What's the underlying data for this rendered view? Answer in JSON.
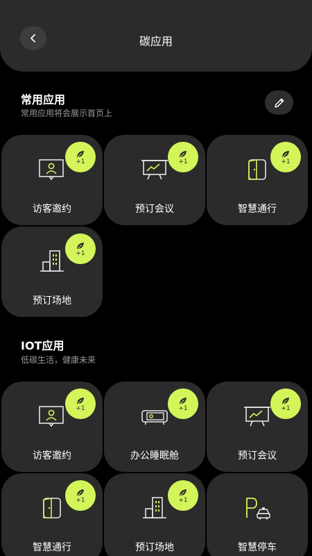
{
  "header": {
    "title": "碳应用"
  },
  "common": {
    "title": "常用应用",
    "subtitle": "常用应用将会展示首页上",
    "tiles": [
      {
        "label": "访客邀约",
        "icon": "visitor-icon",
        "badge": "+1"
      },
      {
        "label": "预订会议",
        "icon": "meeting-board-icon",
        "badge": "+1"
      },
      {
        "label": "智慧通行",
        "icon": "door-icon",
        "badge": "+1"
      },
      {
        "label": "预订场地",
        "icon": "building-icon",
        "badge": "+1"
      }
    ]
  },
  "iot": {
    "title": "IOT应用",
    "subtitle": "低碳生活，健康未来",
    "tiles": [
      {
        "label": "访客邀约",
        "icon": "visitor-icon",
        "badge": "+1"
      },
      {
        "label": "办公睡眠舱",
        "icon": "sleep-pod-icon",
        "badge": "+1"
      },
      {
        "label": "预订会议",
        "icon": "meeting-board-icon",
        "badge": "+1"
      },
      {
        "label": "智慧通行",
        "icon": "door-icon",
        "badge": "+1"
      },
      {
        "label": "预订场地",
        "icon": "building-icon",
        "badge": "+1"
      },
      {
        "label": "智慧停车",
        "icon": "parking-icon",
        "badge": null
      }
    ]
  },
  "colors": {
    "accent": "#d4f55a",
    "tile": "#2b2b2b",
    "background": "#000000"
  }
}
